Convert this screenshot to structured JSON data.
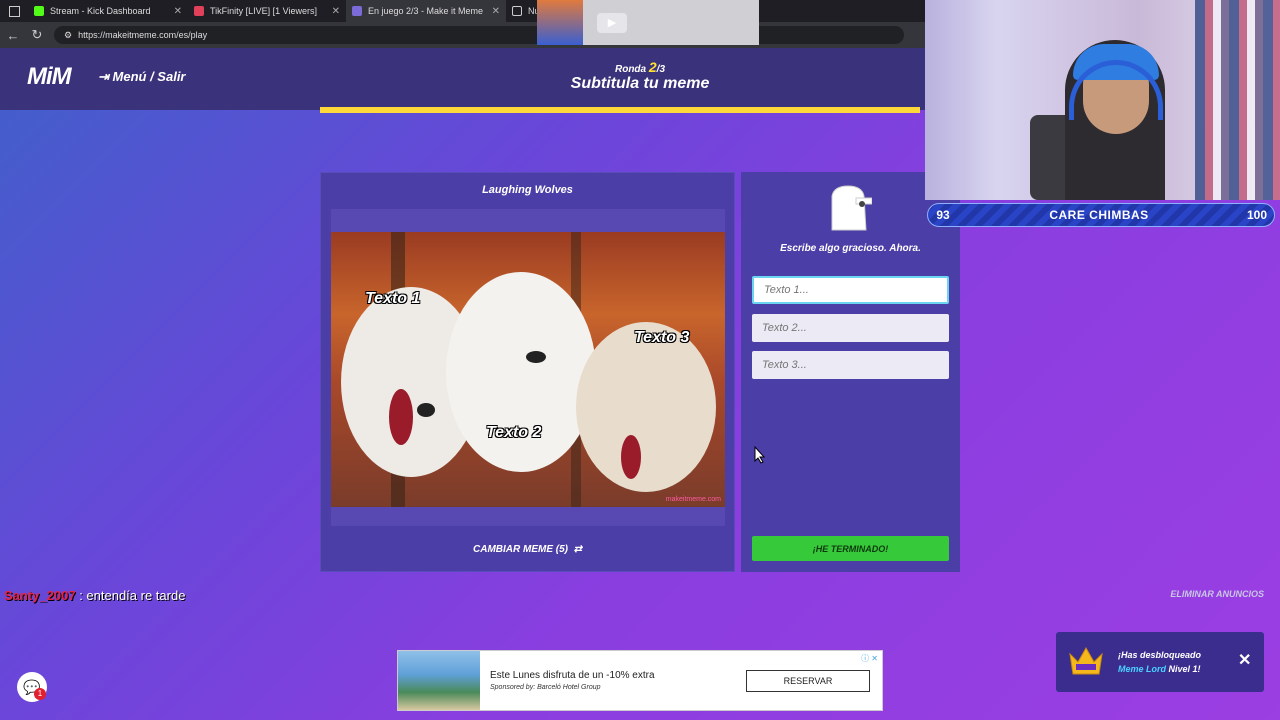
{
  "browser": {
    "tabs": [
      {
        "label": "Stream - Kick Dashboard",
        "color": "#53fc18"
      },
      {
        "label": "TikFinity [LIVE] [1 Viewers]",
        "color": "#e0405a"
      },
      {
        "label": "En juego 2/3 - Make it Meme",
        "color": "#7a6bd8"
      },
      {
        "label": "Nu",
        "color": "#888888"
      }
    ],
    "url": "https://makeitmeme.com/es/play"
  },
  "header": {
    "logo": "MiM",
    "menu_label": "Menú / Salir",
    "round_prefix": "Ronda",
    "round_current": "2",
    "round_total": "/3",
    "title": "Subtitula tu meme",
    "progress": 1.0
  },
  "meme": {
    "title": "Laughing Wolves",
    "captions": [
      "Texto 1",
      "Texto 2",
      "Texto 3"
    ],
    "watermark": "makeitmeme.com",
    "change_label": "CAMBIAR MEME (5)"
  },
  "write": {
    "prompt": "Escribe algo gracioso. Ahora.",
    "placeholders": [
      "Texto 1...",
      "Texto 2...",
      "Texto 3..."
    ],
    "done_label": "¡HE TERMINADO!"
  },
  "overlay": {
    "left_value": "93",
    "name": "CARE CHIMBAS",
    "right_value": "100"
  },
  "chat": {
    "user": "Santy_2007",
    "message": ": entendía re tarde"
  },
  "remove_ads": "ELIMINAR ANUNCIOS",
  "ad": {
    "headline": "Este Lunes disfruta de un -10% extra",
    "sponsor": "Sponsored by: Barceló Hotel Group",
    "cta": "RESERVAR"
  },
  "toast": {
    "text_a": "¡Has desbloqueado ",
    "text_hl": "Meme Lord",
    "text_b": " Nivel 1!"
  },
  "chat_badge": "1"
}
